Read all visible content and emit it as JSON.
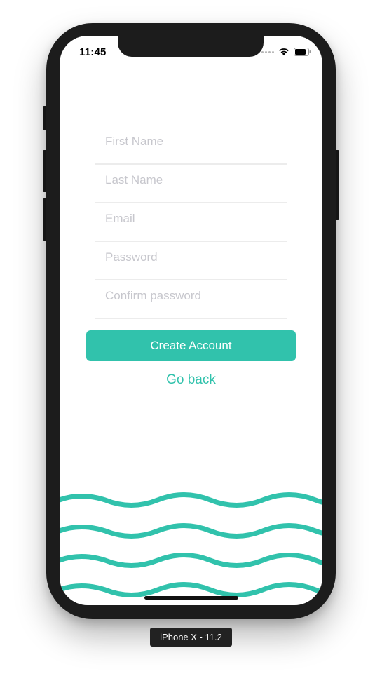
{
  "status_bar": {
    "time": "11:45",
    "icons": [
      "signal-dots-icon",
      "wifi-icon",
      "battery-icon"
    ]
  },
  "form": {
    "first_name_placeholder": "First Name",
    "last_name_placeholder": "Last Name",
    "email_placeholder": "Email",
    "password_placeholder": "Password",
    "confirm_password_placeholder": "Confirm password"
  },
  "actions": {
    "create_account_label": "Create Account",
    "go_back_label": "Go back"
  },
  "simulator": {
    "device_label": "iPhone X - 11.2"
  },
  "colors": {
    "accent": "#31c2ac",
    "device_frame": "#1c1c1c",
    "placeholder": "#c7c7cd",
    "divider": "#ececec"
  }
}
